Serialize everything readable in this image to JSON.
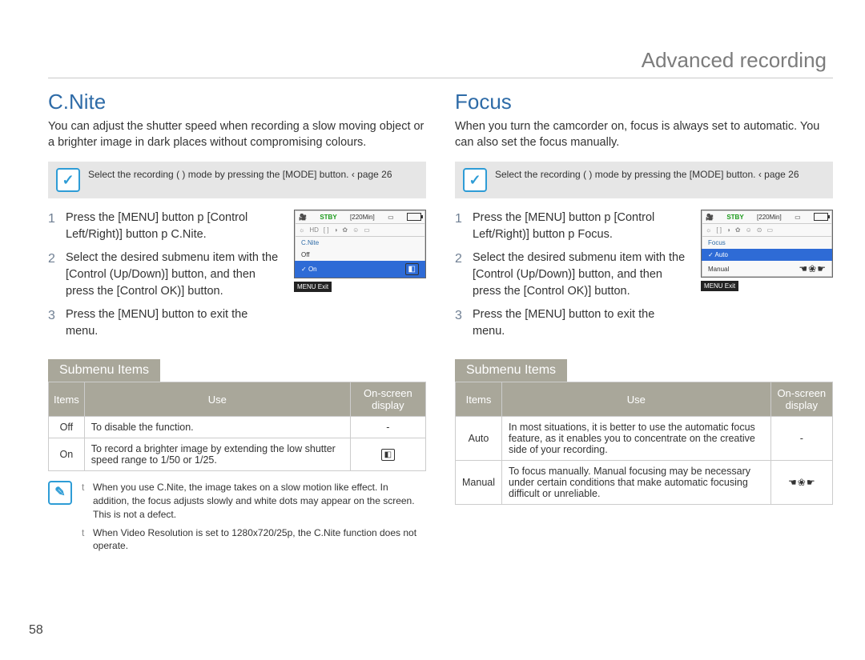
{
  "page_number": "58",
  "header": "Advanced recording",
  "left": {
    "title": "C.Nite",
    "intro": "You can adjust the shutter speed when recording a slow moving object or a brighter image in dark places without compromising colours.",
    "selectbox": "Select the recording (        ) mode by pressing the [MODE] button.  ‹ page 26",
    "steps": [
      "Press the [MENU] button p [Control Left/Right)] button p C.Nite.",
      "Select the desired submenu item with the [Control (Up/Down)] button, and then press the [Control  OK)] button.",
      "Press the [MENU] button to exit the menu."
    ],
    "lcd": {
      "stby": "STBY",
      "time": "[220Min]",
      "label": "C.Nite",
      "rows": [
        "Off",
        "On"
      ],
      "selected": "On",
      "exit": "Exit",
      "menu_btn": "MENU"
    },
    "submenu_title": "Submenu Items",
    "table": {
      "headers": [
        "Items",
        "Use",
        "On-screen display"
      ],
      "rows": [
        {
          "item": "Off",
          "use": "To disable the function.",
          "disp": "-"
        },
        {
          "item": "On",
          "use": "To record a brighter image by extending the low shutter speed range to 1/50 or 1/25.",
          "disp_icon": "cnite"
        }
      ]
    },
    "notes": [
      "When you use C.Nite, the image takes on a slow motion like effect. In addition, the focus adjusts slowly and white dots may appear on the screen. This is not a defect.",
      "When Video Resolution is set to 1280x720/25p, the C.Nite function does not operate."
    ]
  },
  "right": {
    "title": "Focus",
    "intro": "When you turn the camcorder on, focus is always set to automatic. You can also set the focus manually.",
    "selectbox": "Select the recording (        ) mode by pressing the [MODE] button.  ‹ page 26",
    "steps": [
      "Press the [MENU] button p [Control Left/Right)] button p Focus.",
      "Select the desired submenu item with the [Control (Up/Down)] button, and then press the [Control  OK)] button.",
      "Press the [MENU] button to exit the menu."
    ],
    "lcd": {
      "stby": "STBY",
      "time": "[220Min]",
      "label": "Focus",
      "rows": [
        "Auto",
        "Manual"
      ],
      "selected": "Auto",
      "exit": "Exit",
      "menu_btn": "MENU"
    },
    "submenu_title": "Submenu Items",
    "table": {
      "headers": [
        "Items",
        "Use",
        "On-screen display"
      ],
      "rows": [
        {
          "item": "Auto",
          "use": "In most situations, it is better to use the automatic focus feature, as it enables you to concentrate on the creative side of your recording.",
          "disp": "-"
        },
        {
          "item": "Manual",
          "use": "To focus manually. Manual focusing may be necessary under certain conditions that make automatic focusing difficult or unreliable.",
          "disp_icon": "manualfocus"
        }
      ]
    }
  }
}
